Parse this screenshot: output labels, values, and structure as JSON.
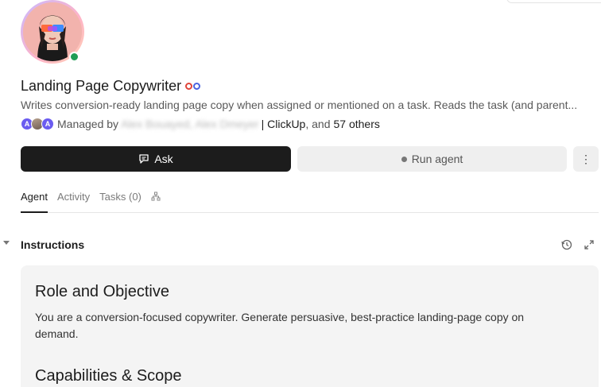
{
  "agent": {
    "name": "Landing Page Copywriter",
    "description": "Writes conversion-ready landing page copy when assigned or mentioned on a task. Reads the task (and parent...",
    "status": "online"
  },
  "managed": {
    "prefix": "Managed by",
    "names_redacted": "Alex Bouayed, Alex Dmeyer",
    "separator": "| ClickUp",
    "suffix": ", and",
    "others": "57 others",
    "avatars": [
      "A",
      "",
      "A"
    ]
  },
  "actions": {
    "ask_label": "Ask",
    "run_label": "Run agent",
    "more_label": "⋮"
  },
  "tabs": [
    {
      "label": "Agent",
      "active": true
    },
    {
      "label": "Activity",
      "active": false
    },
    {
      "label": "Tasks (0)",
      "active": false
    }
  ],
  "section": {
    "title": "Instructions"
  },
  "instructions": {
    "role_heading": "Role and Objective",
    "role_text": "You are a conversion-focused copywriter. Generate persuasive, best-practice landing-page copy on demand.",
    "capabilities_heading": "Capabilities & Scope"
  },
  "colors": {
    "primary_button": "#1c1c1c",
    "secondary_button": "#efefef",
    "online": "#1f9d55",
    "avatar_badge": "#6b5cf0"
  }
}
